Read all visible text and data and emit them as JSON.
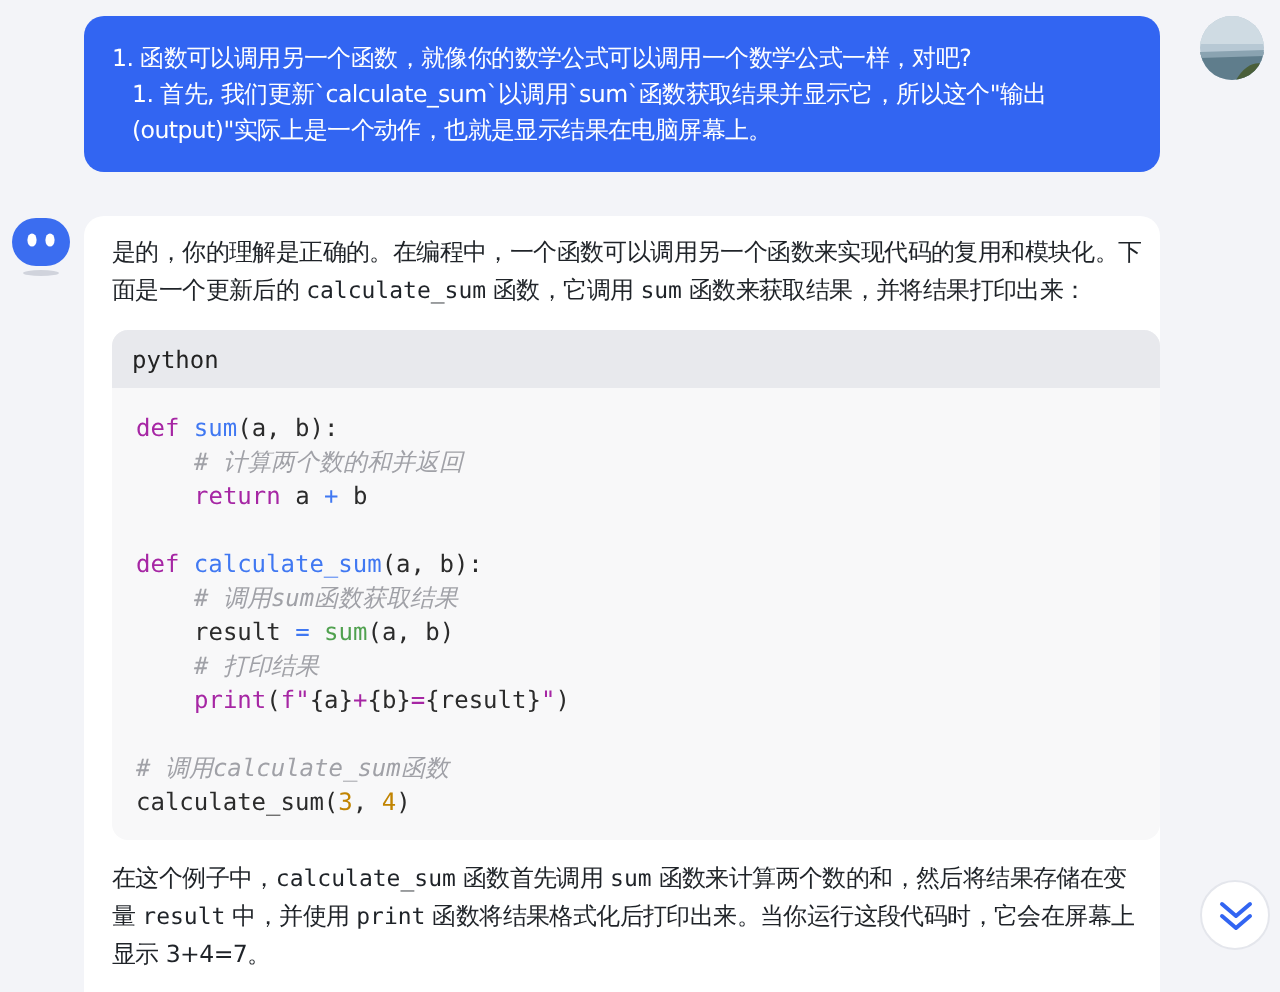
{
  "user_message": {
    "paragraphs": [
      {
        "text": "1. 函数可以调用另一个函数，就像你的数学公式可以调用一个数学公式一样，对吧?",
        "indented": false
      },
      {
        "text": "1. 首先, 我们更新`calculate_sum`以调用`sum`函数获取结果并显示它，所以这个\"输出(output)\"实际上是一个动作，也就是显示结果在电脑屏幕上。",
        "indented": true
      }
    ]
  },
  "assistant_message": {
    "intro": [
      {
        "kind": "text",
        "text": "是的，你的理解是正确的。在编程中，一个函数可以调用另一个函数来实现代码的复用和模块化。下面是一个更新后的 "
      },
      {
        "kind": "code",
        "text": "calculate_sum"
      },
      {
        "kind": "text",
        "text": " 函数，它调用 "
      },
      {
        "kind": "code",
        "text": "sum"
      },
      {
        "kind": "text",
        "text": " 函数来获取结果，并将结果打印出来："
      }
    ],
    "code_block": {
      "language": "python",
      "lines": [
        {
          "kind": "code",
          "indented": false,
          "tokens": [
            {
              "kind": "keyword",
              "text": "def "
            },
            {
              "kind": "function",
              "text": "sum"
            },
            {
              "kind": "plain",
              "text": "(a, b):"
            }
          ]
        },
        {
          "kind": "code",
          "indented": true,
          "tokens": [
            {
              "kind": "comment",
              "text": "# 计算两个数的和并返回"
            }
          ]
        },
        {
          "kind": "code",
          "indented": true,
          "tokens": [
            {
              "kind": "keyword",
              "text": "return"
            },
            {
              "kind": "plain",
              "text": " a "
            },
            {
              "kind": "operator",
              "text": "+"
            },
            {
              "kind": "plain",
              "text": " b"
            }
          ]
        },
        {
          "kind": "blank"
        },
        {
          "kind": "code",
          "indented": false,
          "tokens": [
            {
              "kind": "keyword",
              "text": "def "
            },
            {
              "kind": "function",
              "text": "calculate_sum"
            },
            {
              "kind": "plain",
              "text": "(a, b):"
            }
          ]
        },
        {
          "kind": "code",
          "indented": true,
          "tokens": [
            {
              "kind": "comment",
              "text": "# 调用sum函数获取结果"
            }
          ]
        },
        {
          "kind": "code",
          "indented": true,
          "tokens": [
            {
              "kind": "plain",
              "text": "result "
            },
            {
              "kind": "operator",
              "text": "="
            },
            {
              "kind": "builtin",
              "text": " sum"
            },
            {
              "kind": "plain",
              "text": "(a, b)"
            }
          ]
        },
        {
          "kind": "code",
          "indented": true,
          "tokens": [
            {
              "kind": "comment",
              "text": "# 打印结果"
            }
          ]
        },
        {
          "kind": "code",
          "indented": true,
          "tokens": [
            {
              "kind": "keyword",
              "text": "print"
            },
            {
              "kind": "plain",
              "text": "("
            },
            {
              "kind": "keyword",
              "text": "f\""
            },
            {
              "kind": "plain",
              "text": "{a}"
            },
            {
              "kind": "keyword",
              "text": "+"
            },
            {
              "kind": "plain",
              "text": "{b}"
            },
            {
              "kind": "keyword",
              "text": "="
            },
            {
              "kind": "plain",
              "text": "{result}"
            },
            {
              "kind": "keyword",
              "text": "\""
            },
            {
              "kind": "plain",
              "text": ")"
            }
          ]
        },
        {
          "kind": "blank"
        },
        {
          "kind": "code",
          "indented": false,
          "tokens": [
            {
              "kind": "comment",
              "text": "# 调用calculate_sum函数"
            }
          ]
        },
        {
          "kind": "code",
          "indented": false,
          "tokens": [
            {
              "kind": "plain",
              "text": "calculate_sum("
            },
            {
              "kind": "number",
              "text": "3"
            },
            {
              "kind": "plain",
              "text": ", "
            },
            {
              "kind": "number",
              "text": "4"
            },
            {
              "kind": "plain",
              "text": ")"
            }
          ]
        }
      ]
    },
    "outro": [
      {
        "kind": "text",
        "text": "在这个例子中，"
      },
      {
        "kind": "code",
        "text": "calculate_sum"
      },
      {
        "kind": "text",
        "text": " 函数首先调用 "
      },
      {
        "kind": "code",
        "text": "sum"
      },
      {
        "kind": "text",
        "text": " 函数来计算两个数的和，然后将结果存储在变量 "
      },
      {
        "kind": "code",
        "text": "result"
      },
      {
        "kind": "text",
        "text": " 中，并使用 "
      },
      {
        "kind": "code",
        "text": "print"
      },
      {
        "kind": "text",
        "text": " 函数将结果格式化后打印出来。当你运行这段代码时，它会在屏幕上显示 3+4=7。"
      }
    ]
  }
}
